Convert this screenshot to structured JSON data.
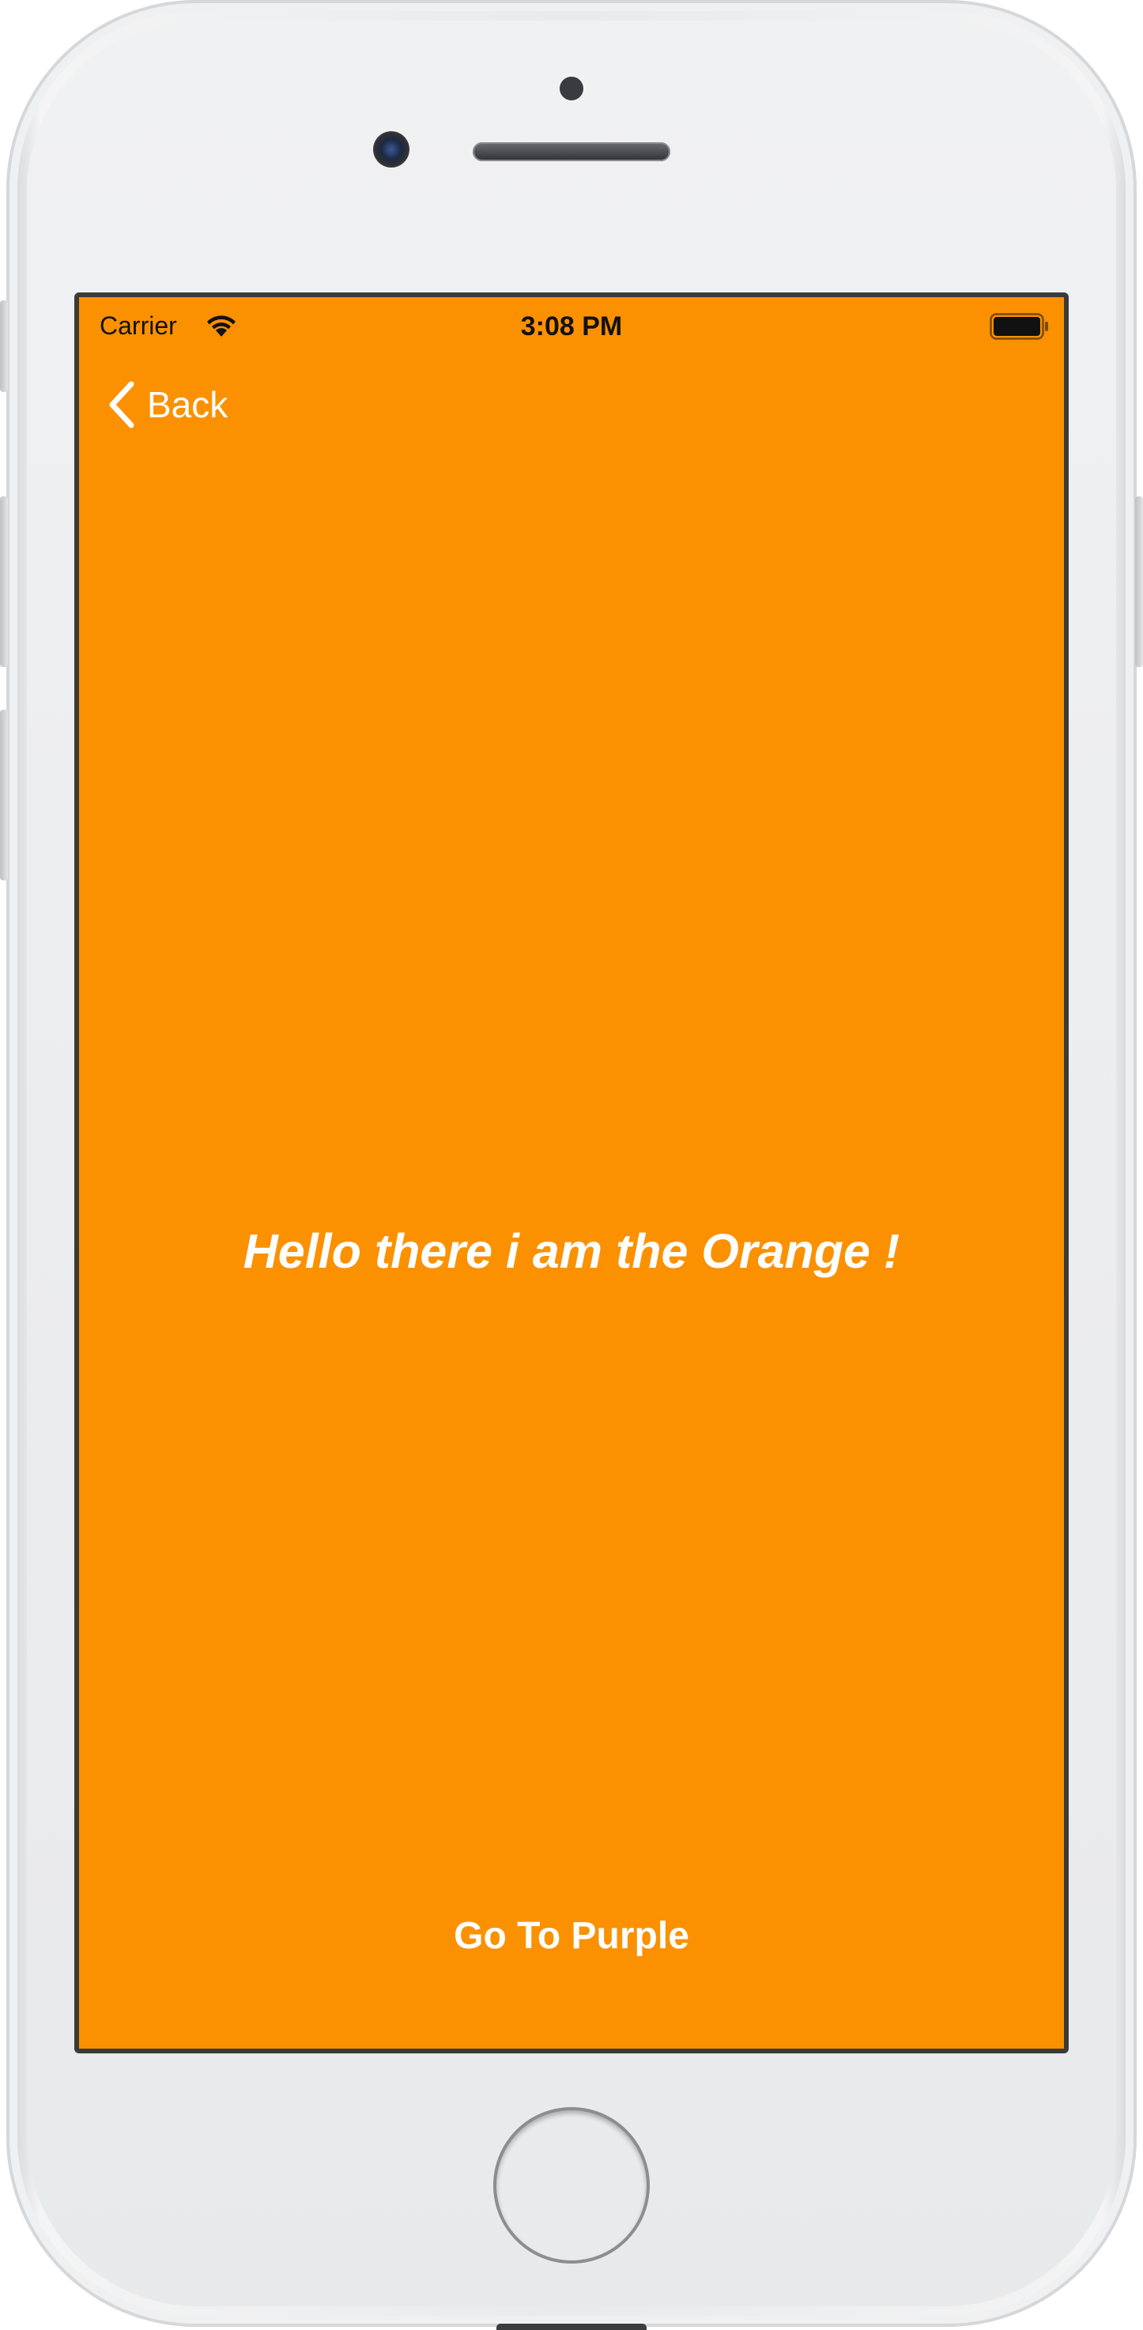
{
  "colors": {
    "screen_background": "#fb9100",
    "text_on_screen": "#ffffff",
    "status_text": "#111111"
  },
  "status_bar": {
    "carrier": "Carrier",
    "time": "3:08 PM",
    "wifi_icon": "wifi-icon",
    "battery_icon": "battery-icon"
  },
  "navigation": {
    "back_label": "Back",
    "back_icon": "chevron-left-icon"
  },
  "main": {
    "headline": "Hello there i am the Orange !",
    "action_button_label": "Go To Purple"
  }
}
